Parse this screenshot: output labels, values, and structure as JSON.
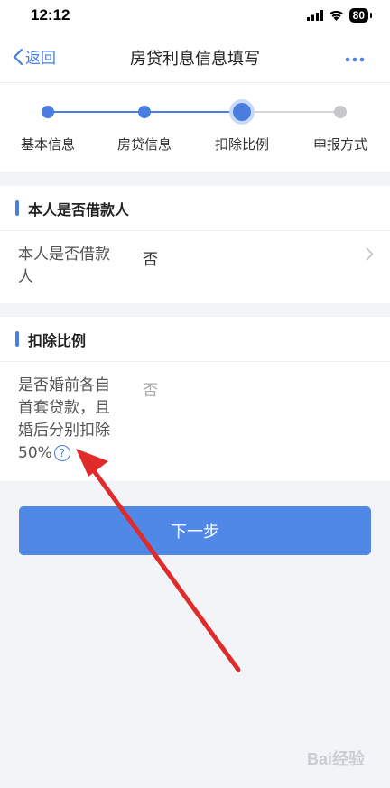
{
  "status_bar": {
    "time": "12:12",
    "battery": "80"
  },
  "nav": {
    "back_label": "返回",
    "title": "房贷利息信息填写"
  },
  "stepper": {
    "steps": [
      {
        "label": "基本信息",
        "state": "done"
      },
      {
        "label": "房贷信息",
        "state": "done"
      },
      {
        "label": "扣除比例",
        "state": "current"
      },
      {
        "label": "申报方式",
        "state": "pending"
      }
    ]
  },
  "borrower_section": {
    "title": "本人是否借款人",
    "field_label_line1": "本人是否借款",
    "field_label_line2": "人",
    "field_value": "否"
  },
  "ratio_section": {
    "title": "扣除比例",
    "field_label_line1": "是否婚前各自",
    "field_label_line2": "首套贷款，且",
    "field_label_line3": "婚后分别扣除",
    "field_label_line4": "50%",
    "field_value": "否",
    "help_glyph": "?"
  },
  "next_button_label": "下一步",
  "watermark": "Bai经验",
  "colors": {
    "accent": "#4a7de0",
    "button": "#5088e8",
    "arrow": "#e02b2b"
  }
}
